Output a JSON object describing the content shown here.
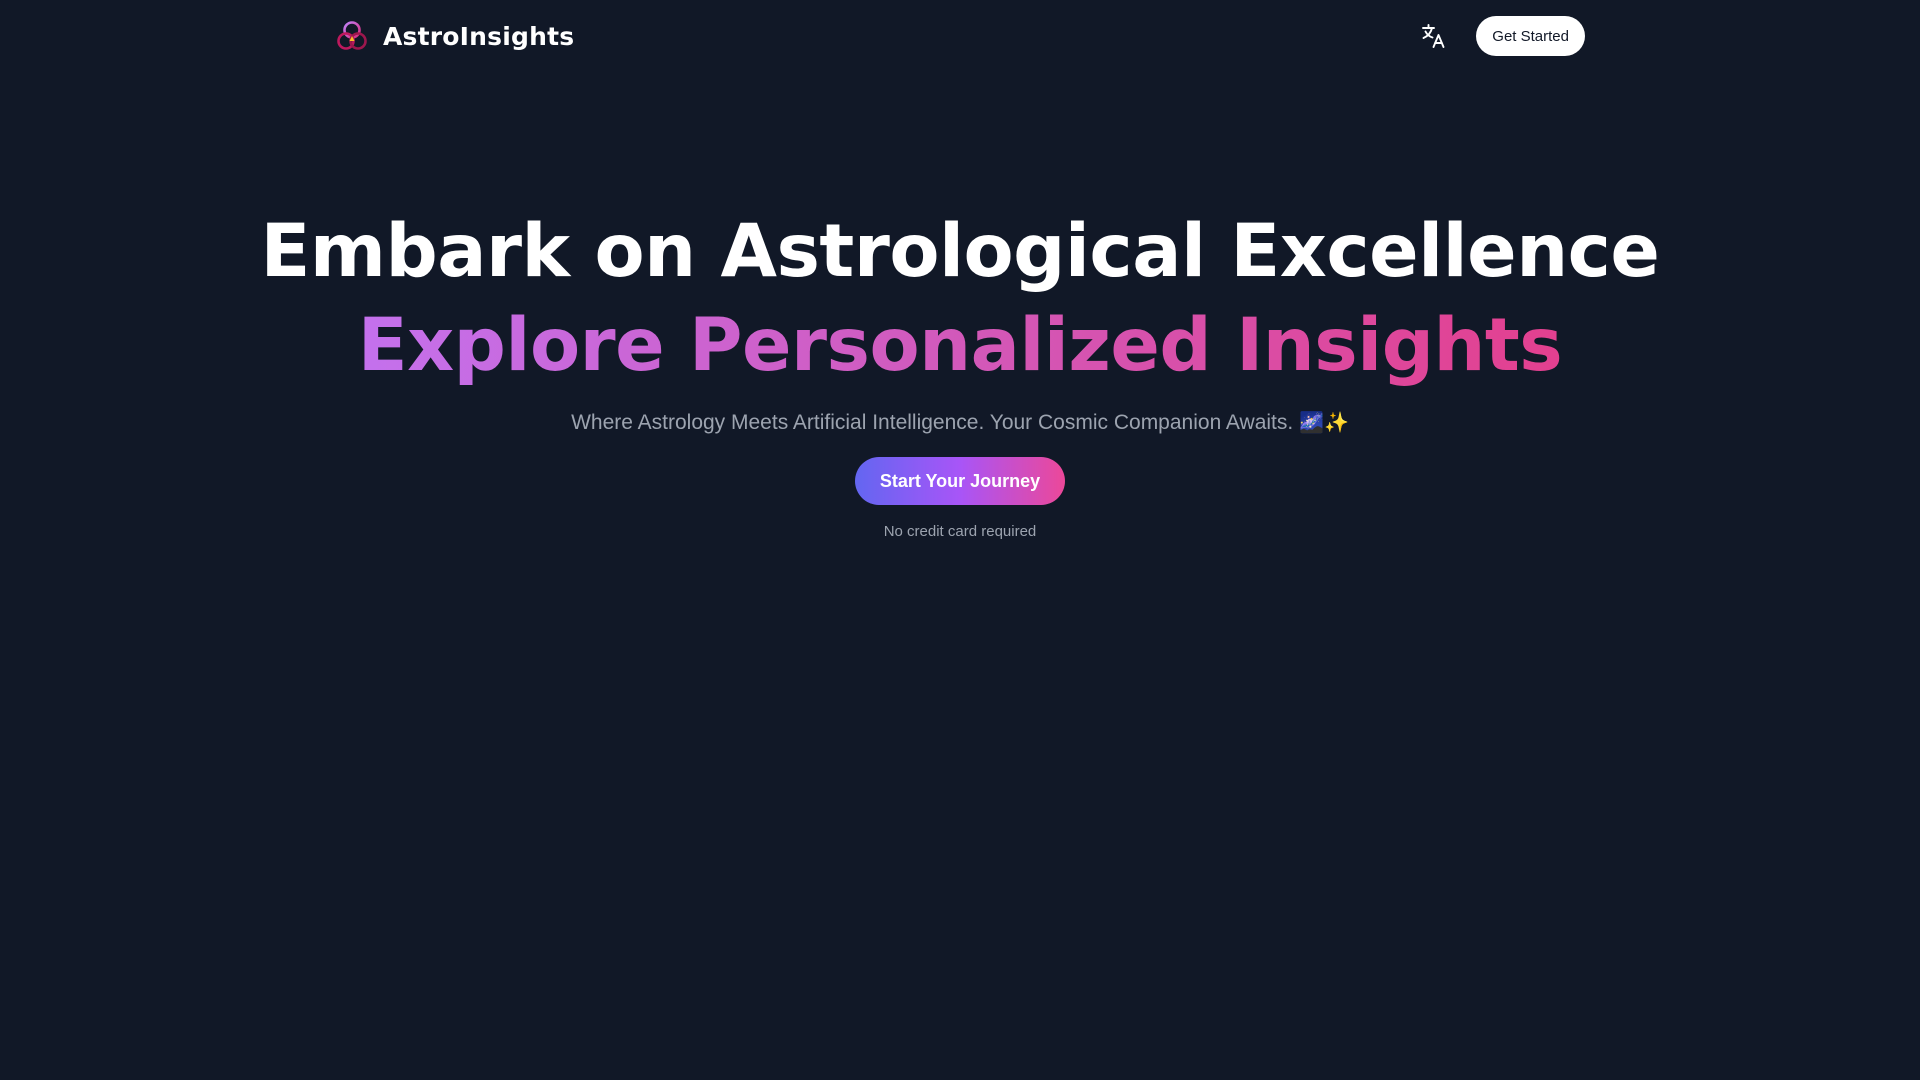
{
  "header": {
    "brand_name": "AstroInsights",
    "logo_icon": "three-rings-logo-icon",
    "language_icon": "translate-icon",
    "get_started_label": "Get Started"
  },
  "hero": {
    "title": "Embark on Astrological Excellence",
    "subtitle": "Explore Personalized Insights",
    "tagline": "Where Astrology Meets Artificial Intelligence. Your Cosmic Companion Awaits.",
    "tagline_emoji": "🌌✨",
    "cta_label": "Start Your Journey",
    "cta_note": "No credit card required"
  },
  "colors": {
    "background": "#111827",
    "text": "#ffffff",
    "muted_text": "#9ca3af",
    "subtitle_gradient": [
      "#c471ed",
      "#e3408f"
    ],
    "cta_gradient": [
      "#6366f1",
      "#a855f7",
      "#ec4899"
    ]
  }
}
